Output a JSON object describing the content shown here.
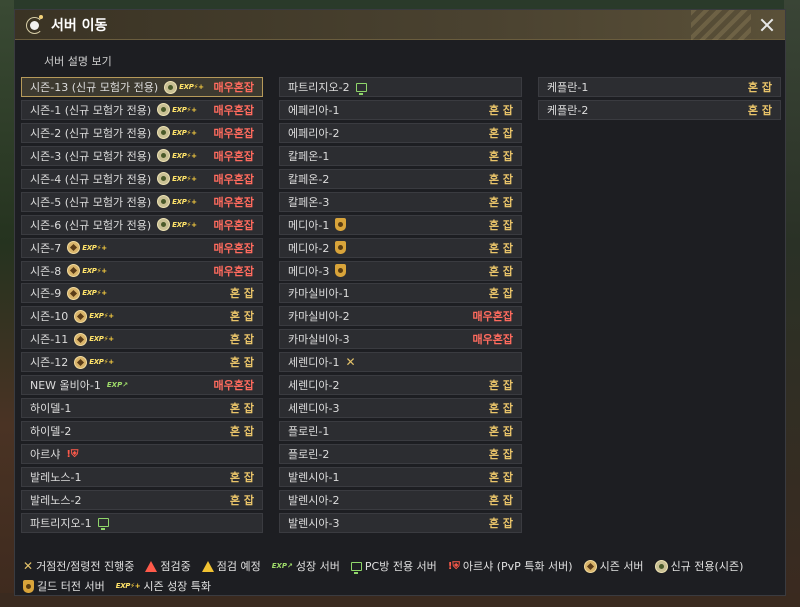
{
  "window": {
    "title": "서버 이동",
    "description_link": "서버 설명 보기"
  },
  "status_labels": {
    "normal": "혼 잡",
    "busy": "매우혼잡"
  },
  "columns": [
    [
      {
        "name": "시즌-13 (신규 모험가 전용)",
        "icons": [
          "newseason",
          "exp"
        ],
        "status": "busy",
        "selected": true
      },
      {
        "name": "시즌-1 (신규 모험가 전용)",
        "icons": [
          "newseason",
          "exp"
        ],
        "status": "busy"
      },
      {
        "name": "시즌-2 (신규 모험가 전용)",
        "icons": [
          "newseason",
          "exp"
        ],
        "status": "busy"
      },
      {
        "name": "시즌-3 (신규 모험가 전용)",
        "icons": [
          "newseason",
          "exp"
        ],
        "status": "busy"
      },
      {
        "name": "시즌-4 (신규 모험가 전용)",
        "icons": [
          "newseason",
          "exp"
        ],
        "status": "busy"
      },
      {
        "name": "시즌-5 (신규 모험가 전용)",
        "icons": [
          "newseason",
          "exp"
        ],
        "status": "busy"
      },
      {
        "name": "시즌-6 (신규 모험가 전용)",
        "icons": [
          "newseason",
          "exp"
        ],
        "status": "busy"
      },
      {
        "name": "시즌-7",
        "icons": [
          "season",
          "exp"
        ],
        "status": "busy"
      },
      {
        "name": "시즌-8",
        "icons": [
          "season",
          "exp"
        ],
        "status": "busy"
      },
      {
        "name": "시즌-9",
        "icons": [
          "season",
          "exp"
        ],
        "status": "normal"
      },
      {
        "name": "시즌-10",
        "icons": [
          "season",
          "exp"
        ],
        "status": "normal"
      },
      {
        "name": "시즌-11",
        "icons": [
          "season",
          "exp"
        ],
        "status": "normal"
      },
      {
        "name": "시즌-12",
        "icons": [
          "season",
          "exp"
        ],
        "status": "normal"
      },
      {
        "name": "NEW 올비아-1",
        "icons": [
          "growth"
        ],
        "status": "busy"
      },
      {
        "name": "하이델-1",
        "icons": [],
        "status": "normal"
      },
      {
        "name": "하이델-2",
        "icons": [],
        "status": "normal"
      },
      {
        "name": "아르샤",
        "icons": [
          "arsha"
        ],
        "status": ""
      },
      {
        "name": "발레노스-1",
        "icons": [],
        "status": "normal"
      },
      {
        "name": "발레노스-2",
        "icons": [],
        "status": "normal"
      },
      {
        "name": "파트리지오-1",
        "icons": [
          "pc"
        ],
        "status": ""
      }
    ],
    [
      {
        "name": "파트리지오-2",
        "icons": [
          "pc"
        ],
        "status": ""
      },
      {
        "name": "에페리아-1",
        "icons": [],
        "status": "normal"
      },
      {
        "name": "에페리아-2",
        "icons": [],
        "status": "normal"
      },
      {
        "name": "칼페온-1",
        "icons": [],
        "status": "normal"
      },
      {
        "name": "칼페온-2",
        "icons": [],
        "status": "normal"
      },
      {
        "name": "칼페온-3",
        "icons": [],
        "status": "normal"
      },
      {
        "name": "메디아-1",
        "icons": [
          "guild"
        ],
        "status": "normal"
      },
      {
        "name": "메디아-2",
        "icons": [
          "guild"
        ],
        "status": "normal"
      },
      {
        "name": "메디아-3",
        "icons": [
          "guild"
        ],
        "status": "normal"
      },
      {
        "name": "카마실비아-1",
        "icons": [],
        "status": "normal"
      },
      {
        "name": "카마실비아-2",
        "icons": [],
        "status": "busy"
      },
      {
        "name": "카마실비아-3",
        "icons": [],
        "status": "busy"
      },
      {
        "name": "세렌디아-1",
        "icons": [
          "war"
        ],
        "status": ""
      },
      {
        "name": "세렌디아-2",
        "icons": [],
        "status": "normal"
      },
      {
        "name": "세렌디아-3",
        "icons": [],
        "status": "normal"
      },
      {
        "name": "플로린-1",
        "icons": [],
        "status": "normal"
      },
      {
        "name": "플로린-2",
        "icons": [],
        "status": "normal"
      },
      {
        "name": "발렌시아-1",
        "icons": [],
        "status": "normal"
      },
      {
        "name": "발렌시아-2",
        "icons": [],
        "status": "normal"
      },
      {
        "name": "발렌시아-3",
        "icons": [],
        "status": "normal"
      }
    ],
    [
      {
        "name": "케플란-1",
        "icons": [],
        "status": "normal"
      },
      {
        "name": "케플란-2",
        "icons": [],
        "status": "normal"
      }
    ]
  ],
  "legend": {
    "line1": [
      {
        "icon": "war",
        "label": "거점전/점령전 진행중"
      },
      {
        "icon": "warn-red",
        "label": "점검중"
      },
      {
        "icon": "warn-yellow",
        "label": "점검 예정"
      },
      {
        "icon": "growth",
        "label": "성장 서버"
      },
      {
        "icon": "pc",
        "label": "PC방 전용 서버"
      },
      {
        "icon": "arsha",
        "label": "아르샤 (PvP 특화 서버)"
      },
      {
        "icon": "season",
        "label": "시즌 서버"
      },
      {
        "icon": "newseason",
        "label": "신규 전용(시즌)"
      }
    ],
    "line2": [
      {
        "icon": "guild",
        "label": "길드 터전 서버"
      },
      {
        "icon": "exp",
        "label": "시즌 성장 특화"
      }
    ]
  },
  "icon_text": {
    "exp": "EXP",
    "exp_arrow": "⚡+",
    "growth": "EXP↗",
    "war": "✕",
    "arsha": "!⛨"
  },
  "colors": {
    "normal": "#e9c46a",
    "busy": "#ff6b5e",
    "accent": "#b69a5a"
  }
}
